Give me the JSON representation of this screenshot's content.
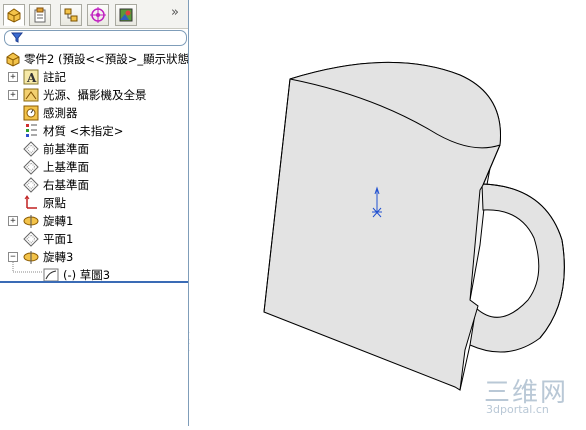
{
  "tree": {
    "part_label": "零件2 (預設<<預設>_顯示狀態",
    "items": [
      {
        "label": "註記"
      },
      {
        "label": "光源、攝影機及全景"
      },
      {
        "label": "感測器"
      },
      {
        "label": "材質 <未指定>"
      },
      {
        "label": "前基準面"
      },
      {
        "label": "上基準面"
      },
      {
        "label": "右基準面"
      },
      {
        "label": "原點"
      },
      {
        "label": "旋轉1"
      },
      {
        "label": "平面1"
      },
      {
        "label": "旋轉3"
      },
      {
        "label": "(-) 草圖3"
      }
    ]
  },
  "tabs_more": "»",
  "watermark": {
    "main": "三维网",
    "sub": "3dportal.cn"
  },
  "colors": {
    "accent": "#3a6bb5",
    "model_face": "#e3e3e3",
    "model_edge": "#000000"
  },
  "icons": [
    "feature-manager-icon",
    "property-manager-icon",
    "configuration-manager-icon",
    "dim-xpert-icon",
    "display-manager-icon",
    "filter-icon",
    "part-icon",
    "annotation-icon",
    "lights-icon",
    "sensor-icon",
    "material-icon",
    "plane-icon",
    "origin-icon",
    "revolve-icon",
    "sketch-icon"
  ]
}
